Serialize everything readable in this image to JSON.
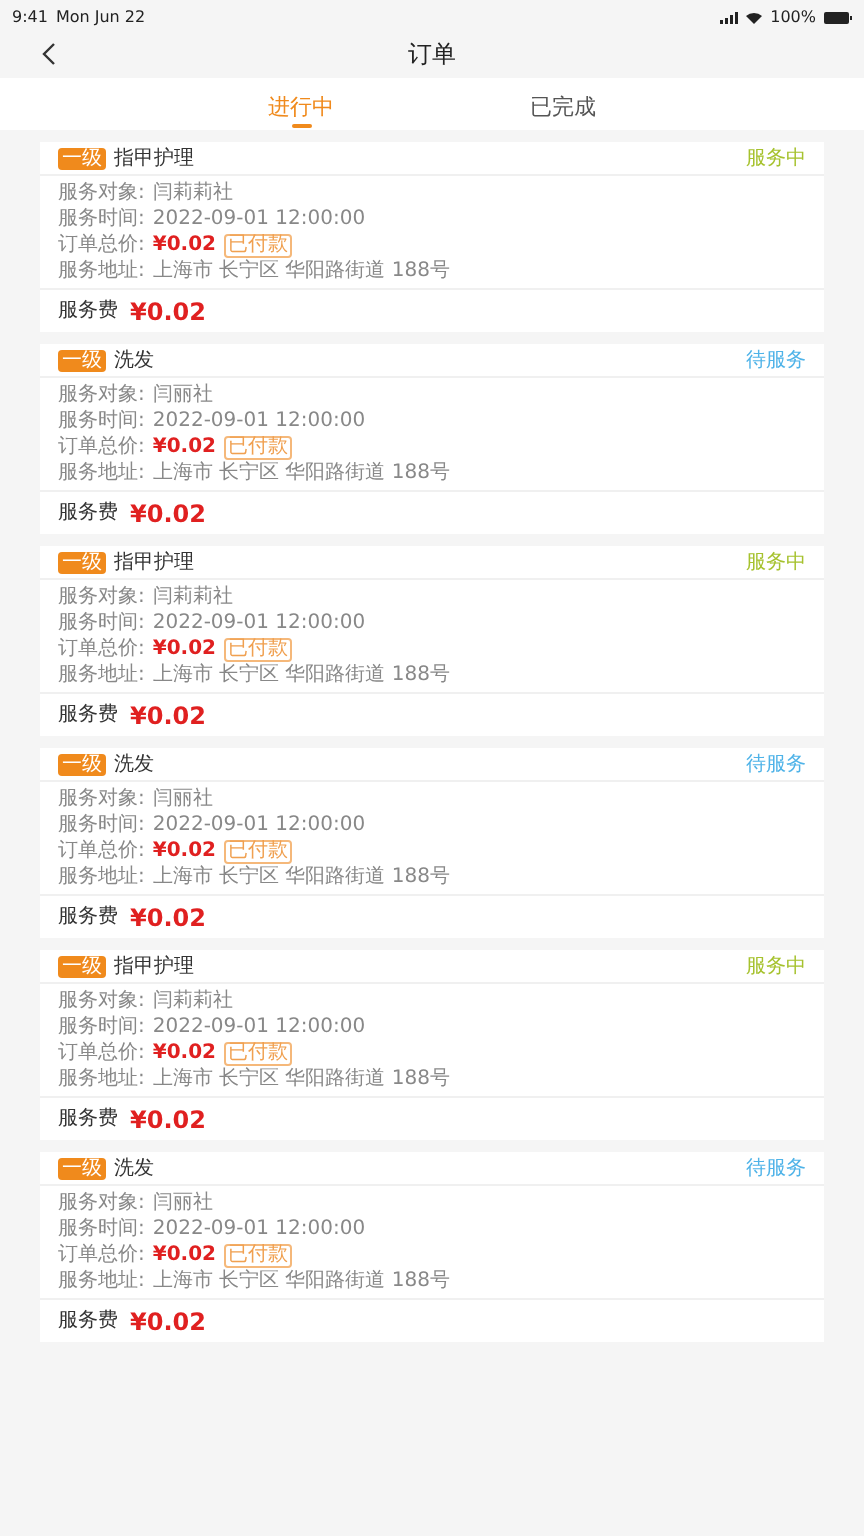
{
  "status_bar": {
    "time": "9:41",
    "date": "Mon Jun 22",
    "battery": "100%"
  },
  "nav": {
    "title": "订单"
  },
  "tabs": [
    {
      "label": "进行中",
      "selected": true
    },
    {
      "label": "已完成",
      "selected": false
    }
  ],
  "orders": [
    {
      "tag": "一级",
      "service": "指甲护理",
      "status": {
        "text": "服务中",
        "color": "#a6c22e"
      },
      "target_label": "服务对象:",
      "target": "闫莉莉社",
      "time_label": "服务时间:",
      "time": "2022-09-01 12:00:00",
      "total_label": "订单总价:",
      "total": "¥0.02",
      "paid": "已付款",
      "address_label": "服务地址:",
      "address": "上海市 长宁区 华阳路街道 188号",
      "fee_label": "服务费",
      "fee": "¥0.02"
    },
    {
      "tag": "一级",
      "service": "洗发",
      "status": {
        "text": "待服务",
        "color": "#4fb3e8"
      },
      "target_label": "服务对象:",
      "target": "闫丽社",
      "time_label": "服务时间:",
      "time": "2022-09-01 12:00:00",
      "total_label": "订单总价:",
      "total": "¥0.02",
      "paid": "已付款",
      "address_label": "服务地址:",
      "address": "上海市 长宁区 华阳路街道 188号",
      "fee_label": "服务费",
      "fee": "¥0.02"
    },
    {
      "tag": "一级",
      "service": "指甲护理",
      "status": {
        "text": "服务中",
        "color": "#a6c22e"
      },
      "target_label": "服务对象:",
      "target": "闫莉莉社",
      "time_label": "服务时间:",
      "time": "2022-09-01 12:00:00",
      "total_label": "订单总价:",
      "total": "¥0.02",
      "paid": "已付款",
      "address_label": "服务地址:",
      "address": "上海市 长宁区 华阳路街道 188号",
      "fee_label": "服务费",
      "fee": "¥0.02"
    },
    {
      "tag": "一级",
      "service": "洗发",
      "status": {
        "text": "待服务",
        "color": "#4fb3e8"
      },
      "target_label": "服务对象:",
      "target": "闫丽社",
      "time_label": "服务时间:",
      "time": "2022-09-01 12:00:00",
      "total_label": "订单总价:",
      "total": "¥0.02",
      "paid": "已付款",
      "address_label": "服务地址:",
      "address": "上海市 长宁区 华阳路街道 188号",
      "fee_label": "服务费",
      "fee": "¥0.02"
    },
    {
      "tag": "一级",
      "service": "指甲护理",
      "status": {
        "text": "服务中",
        "color": "#a6c22e"
      },
      "target_label": "服务对象:",
      "target": "闫莉莉社",
      "time_label": "服务时间:",
      "time": "2022-09-01 12:00:00",
      "total_label": "订单总价:",
      "total": "¥0.02",
      "paid": "已付款",
      "address_label": "服务地址:",
      "address": "上海市 长宁区 华阳路街道 188号",
      "fee_label": "服务费",
      "fee": "¥0.02"
    },
    {
      "tag": "一级",
      "service": "洗发",
      "status": {
        "text": "待服务",
        "color": "#4fb3e8"
      },
      "target_label": "服务对象:",
      "target": "闫丽社",
      "time_label": "服务时间:",
      "time": "2022-09-01 12:00:00",
      "total_label": "订单总价:",
      "total": "¥0.02",
      "paid": "已付款",
      "address_label": "服务地址:",
      "address": "上海市 长宁区 华阳路街道 188号",
      "fee_label": "服务费",
      "fee": "¥0.02"
    }
  ]
}
